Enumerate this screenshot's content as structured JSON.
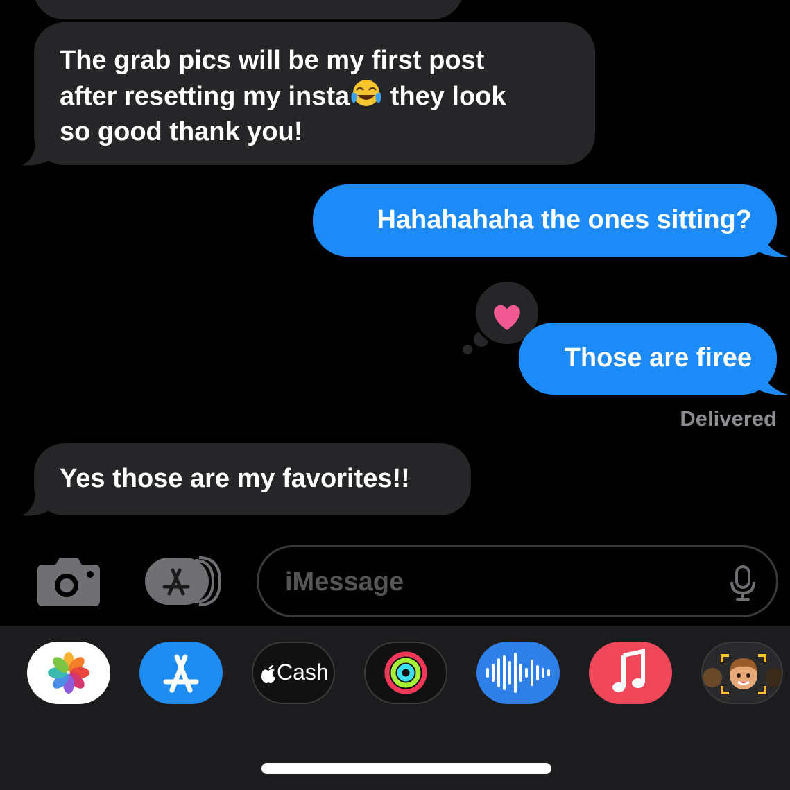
{
  "messages": [
    {
      "id": "m1",
      "direction": "received",
      "line1": "The grab pics will be my first post",
      "line2a": "after resetting my insta",
      "line2b": " they look",
      "line3": "so good thank you!",
      "emoji": "face-with-tears-of-joy"
    },
    {
      "id": "m2",
      "direction": "sent",
      "text": "Hahahahaha the ones sitting?"
    },
    {
      "id": "m3",
      "direction": "sent",
      "text": "Those are firee",
      "reaction": "heart"
    },
    {
      "id": "m4",
      "direction": "received",
      "text": "Yes those are my favorites!!"
    }
  ],
  "status": {
    "delivered": "Delivered"
  },
  "composer": {
    "placeholder": "iMessage",
    "camera_icon": "camera-icon",
    "apps_icon": "app-store-icon",
    "mic_icon": "microphone-icon"
  },
  "app_tray": {
    "apps": [
      {
        "name": "Photos",
        "icon": "photos-icon"
      },
      {
        "name": "App Store",
        "icon": "app-store-icon"
      },
      {
        "name": "Apple Cash",
        "label": "Cash",
        "icon": "apple-cash-icon"
      },
      {
        "name": "Fitness",
        "icon": "activity-rings-icon"
      },
      {
        "name": "Audio Message",
        "icon": "waveform-icon"
      },
      {
        "name": "Music",
        "icon": "music-note-icon"
      },
      {
        "name": "Memoji",
        "icon": "memoji-icon"
      }
    ]
  },
  "colors": {
    "background": "#000000",
    "received_bubble": "#262629",
    "sent_bubble": "#1c8af7",
    "heart": "#f25a93",
    "tray": "#1c1c1e"
  }
}
